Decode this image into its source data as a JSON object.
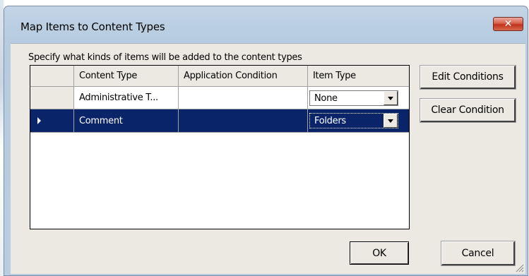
{
  "window": {
    "title": "Map Items to Content Types",
    "close_label": "✕"
  },
  "group_label": "Specify what kinds of items will be added to the content types",
  "grid": {
    "columns": [
      "Content Type",
      "Application Condition",
      "Item Type"
    ],
    "rows": [
      {
        "content_type": "Administrative T...",
        "condition": "",
        "item_type": "None",
        "selected": false
      },
      {
        "content_type": "Comment",
        "condition": "",
        "item_type": "Folders",
        "selected": true
      }
    ]
  },
  "buttons": {
    "edit_conditions": "Edit Conditions",
    "clear_condition": "Clear Condition",
    "ok": "OK",
    "cancel": "Cancel"
  },
  "colors": {
    "selection": "#0a246a",
    "dialog_face": "#ebe9e2",
    "close_button": "#c2321b"
  },
  "icons": {
    "close": "close-icon",
    "row_pointer": "row-pointer-icon",
    "dropdown": "chevron-down-icon",
    "grip": "resize-grip-icon"
  }
}
